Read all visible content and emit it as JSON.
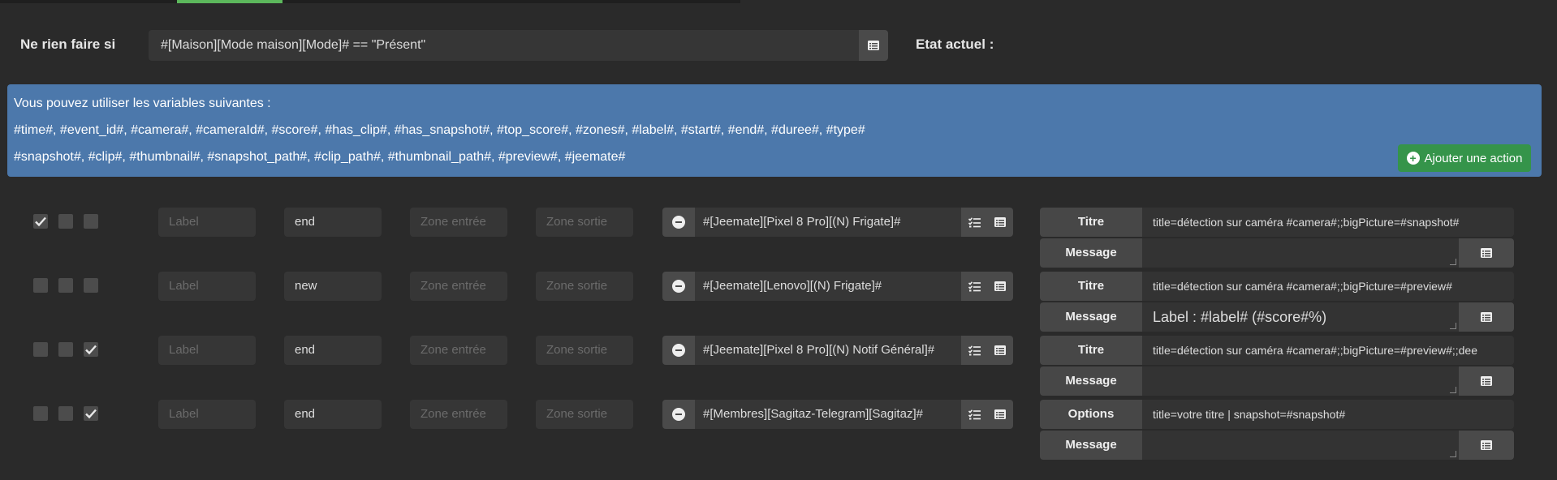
{
  "condition": {
    "label": "Ne rien faire si",
    "value": "#[Maison][Mode maison][Mode]# == \"Présent\"",
    "state_label": "Etat actuel :"
  },
  "info": {
    "line1": "Vous pouvez utiliser les variables suivantes :",
    "line2": "#time#, #event_id#, #camera#, #cameraId#, #score#, #has_clip#, #has_snapshot#, #top_score#, #zones#, #label#, #start#, #end#, #duree#, #type#",
    "line3": "#snapshot#, #clip#, #thumbnail#, #snapshot_path#, #clip_path#, #thumbnail_path#, #preview#, #jeemate#"
  },
  "add_action_label": "Ajouter une action",
  "placeholders": {
    "label": "Label",
    "zone_in": "Zone entrée",
    "zone_out": "Zone sortie"
  },
  "actions": [
    {
      "checks": [
        true,
        false,
        false
      ],
      "type": "end",
      "cmd": "#[Jeemate][Pixel 8 Pro][(N) Frigate]#",
      "param1_label": "Titre",
      "param1_value": "title=détection sur caméra #camera#;;bigPicture=#snapshot#",
      "param2_label": "Message",
      "param2_value": ""
    },
    {
      "checks": [
        false,
        false,
        false
      ],
      "type": "new",
      "cmd": "#[Jeemate][Lenovo][(N) Frigate]#",
      "param1_label": "Titre",
      "param1_value": "title=détection sur caméra #camera#;;bigPicture=#preview#",
      "param2_label": "Message",
      "param2_value": "Label : #label# (#score#%)"
    },
    {
      "checks": [
        false,
        false,
        true
      ],
      "type": "end",
      "cmd": "#[Jeemate][Pixel 8 Pro][(N) Notif Général]#",
      "param1_label": "Titre",
      "param1_value": "title=détection sur caméra #camera#;;bigPicture=#preview#;;dee",
      "param2_label": "Message",
      "param2_value": ""
    },
    {
      "checks": [
        false,
        false,
        true
      ],
      "type": "end",
      "cmd": "#[Membres][Sagitaz-Telegram][Sagitaz]#",
      "param1_label": "Options",
      "param1_value": "title=votre titre | snapshot=#snapshot#",
      "param2_label": "Message",
      "param2_value": ""
    }
  ]
}
